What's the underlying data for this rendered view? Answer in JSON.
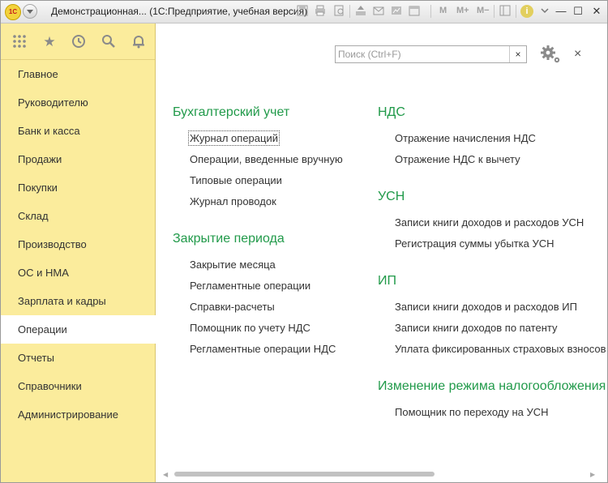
{
  "window": {
    "logo_text": "1С",
    "title": "Демонстрационная... (1С:Предприятие, учебная версия)",
    "toolbar_m": "M",
    "toolbar_m_plus": "M+",
    "toolbar_m_minus": "M−",
    "info": "i",
    "minimize": "—",
    "maximize": "☐",
    "close": "✕"
  },
  "sidebar": {
    "items": [
      {
        "label": "Главное"
      },
      {
        "label": "Руководителю"
      },
      {
        "label": "Банк и касса"
      },
      {
        "label": "Продажи"
      },
      {
        "label": "Покупки"
      },
      {
        "label": "Склад"
      },
      {
        "label": "Производство"
      },
      {
        "label": "ОС и НМА"
      },
      {
        "label": "Зарплата и кадры"
      },
      {
        "label": "Операции",
        "active": true
      },
      {
        "label": "Отчеты"
      },
      {
        "label": "Справочники"
      },
      {
        "label": "Администрирование"
      }
    ]
  },
  "search": {
    "placeholder": "Поиск (Ctrl+F)",
    "value": "",
    "clear": "×"
  },
  "close_panel": "×",
  "groups": {
    "accounting": {
      "title": "Бухгалтерский учет",
      "items": [
        "Журнал операций",
        "Операции, введенные вручную",
        "Типовые операции",
        "Журнал проводок"
      ]
    },
    "closing": {
      "title": "Закрытие периода",
      "items": [
        "Закрытие месяца",
        "Регламентные операции",
        "Справки-расчеты",
        "Помощник по учету НДС",
        "Регламентные операции НДС"
      ]
    },
    "vat": {
      "title": "НДС",
      "items": [
        "Отражение начисления НДС",
        "Отражение НДС к вычету"
      ]
    },
    "usn": {
      "title": "УСН",
      "items": [
        "Записи книги доходов и расходов УСН",
        "Регистрация суммы убытка УСН"
      ]
    },
    "ip": {
      "title": "ИП",
      "items": [
        "Записи книги доходов и расходов ИП",
        "Записи книги доходов по патенту",
        "Уплата фиксированных страховых взносов"
      ]
    },
    "tax_mode": {
      "title": "Изменение режима налогообложения",
      "items": [
        "Помощник по переходу на УСН"
      ]
    }
  },
  "colors": {
    "sidebar_bg": "#fbec9c",
    "group_title": "#219a4a"
  }
}
